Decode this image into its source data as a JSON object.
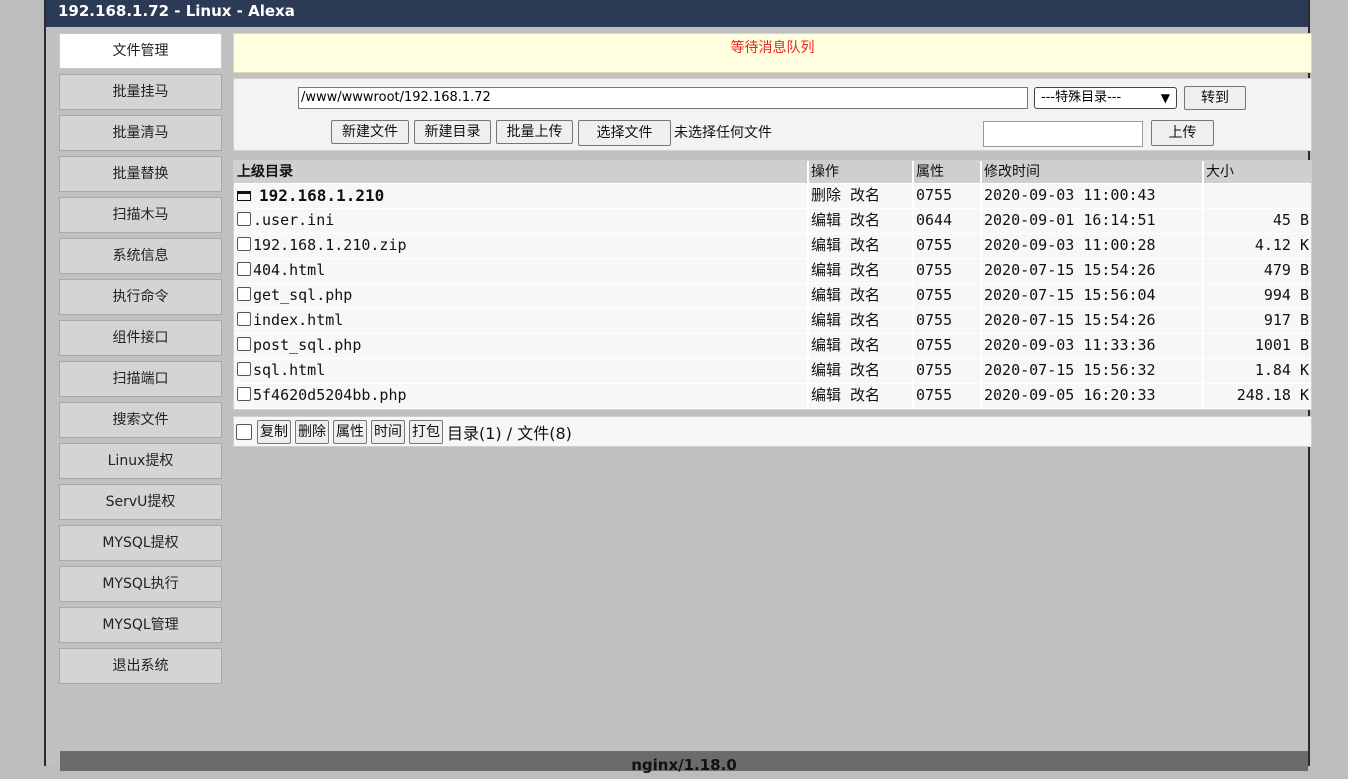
{
  "window": {
    "title": "192.168.1.72 - Linux - Alexa"
  },
  "sidebar": {
    "items": [
      {
        "label": "文件管理"
      },
      {
        "label": "批量挂马"
      },
      {
        "label": "批量清马"
      },
      {
        "label": "批量替换"
      },
      {
        "label": "扫描木马"
      },
      {
        "label": "系统信息"
      },
      {
        "label": "执行命令"
      },
      {
        "label": "组件接口"
      },
      {
        "label": "扫描端口"
      },
      {
        "label": "搜索文件"
      },
      {
        "label": "Linux提权"
      },
      {
        "label": "ServU提权"
      },
      {
        "label": "MYSQL提权"
      },
      {
        "label": "MYSQL执行"
      },
      {
        "label": "MYSQL管理"
      },
      {
        "label": "退出系统"
      }
    ]
  },
  "message": {
    "text": "等待消息队列"
  },
  "toolbar": {
    "path_value": "/www/wwwroot/192.168.1.72",
    "special_select": "---特殊目录---",
    "goto_label": "转到",
    "new_file_label": "新建文件",
    "new_dir_label": "新建目录",
    "batch_upload_label": "批量上传",
    "choose_file_label": "选择文件",
    "no_file_text": "未选择任何文件",
    "upload_label": "上传"
  },
  "table": {
    "headers": {
      "name": "上级目录",
      "ops": "操作",
      "perm": "属性",
      "time": "修改时间",
      "size": "大小"
    },
    "dir": {
      "name": "192.168.1.210",
      "op1": "删除",
      "op2": "改名",
      "perm": "0755",
      "time": "2020-09-03 11:00:43",
      "size": ""
    },
    "files": [
      {
        "name": ".user.ini",
        "op1": "编辑",
        "op2": "改名",
        "perm": "0644",
        "time": "2020-09-01 16:14:51",
        "size": "45 B"
      },
      {
        "name": "192.168.1.210.zip",
        "op1": "编辑",
        "op2": "改名",
        "perm": "0755",
        "time": "2020-09-03 11:00:28",
        "size": "4.12 K"
      },
      {
        "name": "404.html",
        "op1": "编辑",
        "op2": "改名",
        "perm": "0755",
        "time": "2020-07-15 15:54:26",
        "size": "479 B"
      },
      {
        "name": "get_sql.php",
        "op1": "编辑",
        "op2": "改名",
        "perm": "0755",
        "time": "2020-07-15 15:56:04",
        "size": "994 B"
      },
      {
        "name": "index.html",
        "op1": "编辑",
        "op2": "改名",
        "perm": "0755",
        "time": "2020-07-15 15:54:26",
        "size": "917 B"
      },
      {
        "name": "post_sql.php",
        "op1": "编辑",
        "op2": "改名",
        "perm": "0755",
        "time": "2020-09-03 11:33:36",
        "size": "1001 B"
      },
      {
        "name": "sql.html",
        "op1": "编辑",
        "op2": "改名",
        "perm": "0755",
        "time": "2020-07-15 15:56:32",
        "size": "1.84 K"
      },
      {
        "name": "5f4620d5204bb.php",
        "op1": "编辑",
        "op2": "改名",
        "perm": "0755",
        "time": "2020-09-05 16:20:33",
        "size": "248.18 K"
      }
    ]
  },
  "bottom": {
    "copy_label": "复制",
    "delete_label": "删除",
    "attr_label": "属性",
    "time_label": "时间",
    "pack_label": "打包",
    "counts_text": "目录(1) / 文件(8)"
  },
  "footer": {
    "text": "nginx/1.18.0"
  }
}
